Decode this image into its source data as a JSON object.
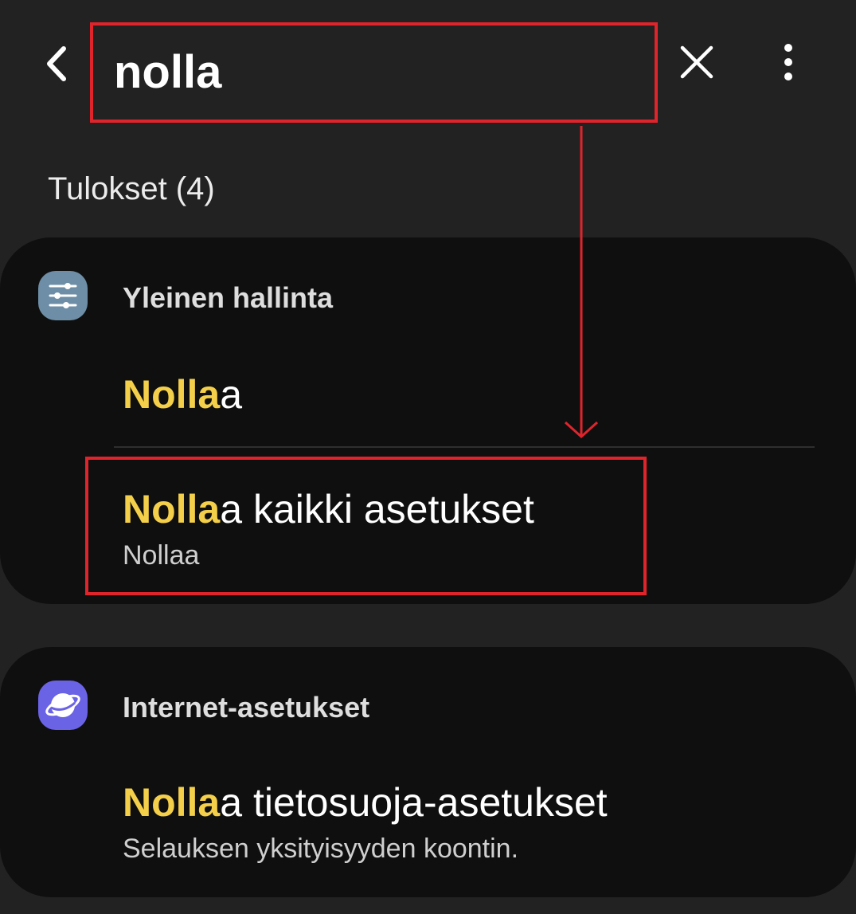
{
  "header": {
    "search_value": "nolla",
    "back_icon": "chevron-left-icon",
    "clear_icon": "close-icon",
    "more_icon": "more-vertical-icon"
  },
  "results": {
    "count_label": "Tulokset (4)"
  },
  "groups": [
    {
      "app_label": "Yleinen hallinta",
      "icon": "sliders-icon",
      "items": [
        {
          "title_highlight": "Nolla",
          "title_rest": "a",
          "subtitle": ""
        },
        {
          "title_highlight": "Nolla",
          "title_rest": "a kaikki asetukset",
          "subtitle": "Nollaa"
        }
      ]
    },
    {
      "app_label": "Internet-asetukset",
      "icon": "planet-icon",
      "items": [
        {
          "title_highlight": "Nolla",
          "title_rest": "a tietosuoja-asetukset",
          "subtitle": "Selauksen yksityisyyden koontin."
        }
      ]
    }
  ],
  "colors": {
    "background": "#222222",
    "card": "#0f0f0f",
    "highlight": "#f4cf4a",
    "annotation": "#e0242c",
    "settings_icon_bg": "#6d8ea6",
    "internet_icon_bg": "#6b63e6"
  }
}
